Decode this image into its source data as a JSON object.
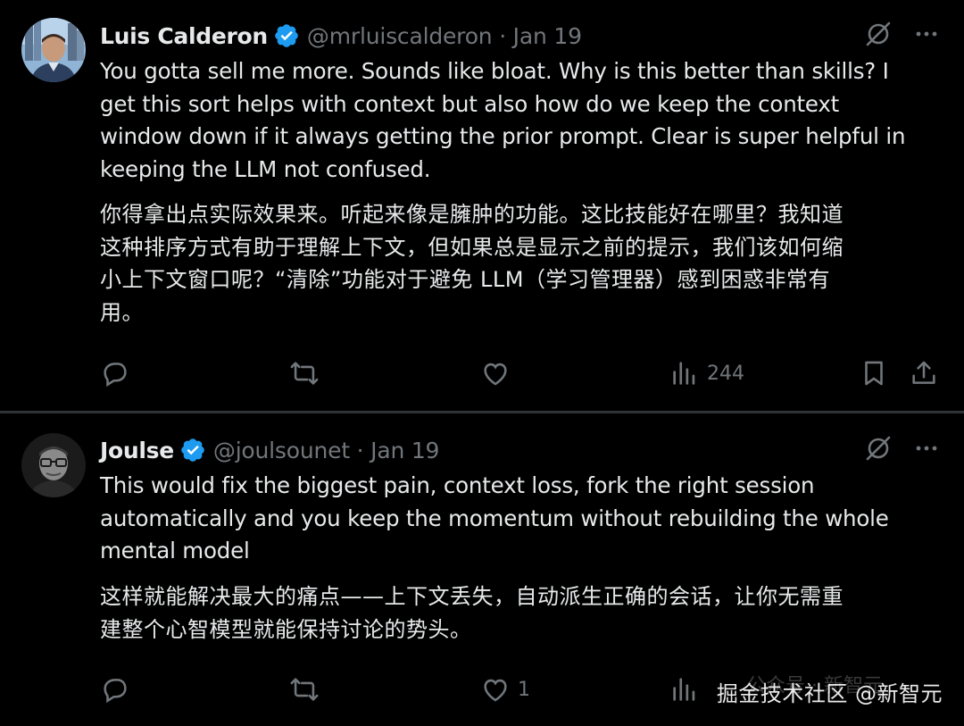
{
  "tweets": [
    {
      "author_name": "Luis Calderon",
      "handle_date": "@mrluiscalderon · Jan 19",
      "text_en": "You gotta sell me more. Sounds like bloat. Why is this better than skills? I\nget this sort helps with context but also how do we keep the context\nwindow down if it always getting the prior prompt. Clear is super helpful in\nkeeping the LLM not confused.",
      "text_zh": "你得拿出点实际效果来。听起来像是臃肿的功能。这比技能好在哪里？我知道\n这种排序方式有助于理解上下文，但如果总是显示之前的提示，我们该如何缩\n小上下文窗口呢？“清除”功能对于避免 LLM（学习管理器）感到困惑非常有\n用。",
      "views": "244",
      "likes": ""
    },
    {
      "author_name": "Joulse",
      "handle_date": "@joulsounet · Jan 19",
      "text_en": "This would fix the biggest pain, context loss, fork the right session\nautomatically and you keep the momentum without rebuilding the whole\nmental model",
      "text_zh": "这样就能解决最大的痛点——上下文丢失，自动派生正确的会话，让你无需重\n建整个心智模型就能保持讨论的势头。",
      "views": "",
      "likes": "1"
    }
  ],
  "watermark": "掘金技术社区 @新智元",
  "watermark_faint": "公众号 · 新智元",
  "colors": {
    "background": "#000000",
    "text": "#e7e9ea",
    "muted": "#71767b",
    "verified": "#1d9bf0"
  },
  "icons": [
    "verified-badge-icon",
    "grok-icon",
    "more-icon",
    "reply-icon",
    "retweet-icon",
    "like-icon",
    "views-icon",
    "bookmark-icon",
    "share-icon"
  ]
}
